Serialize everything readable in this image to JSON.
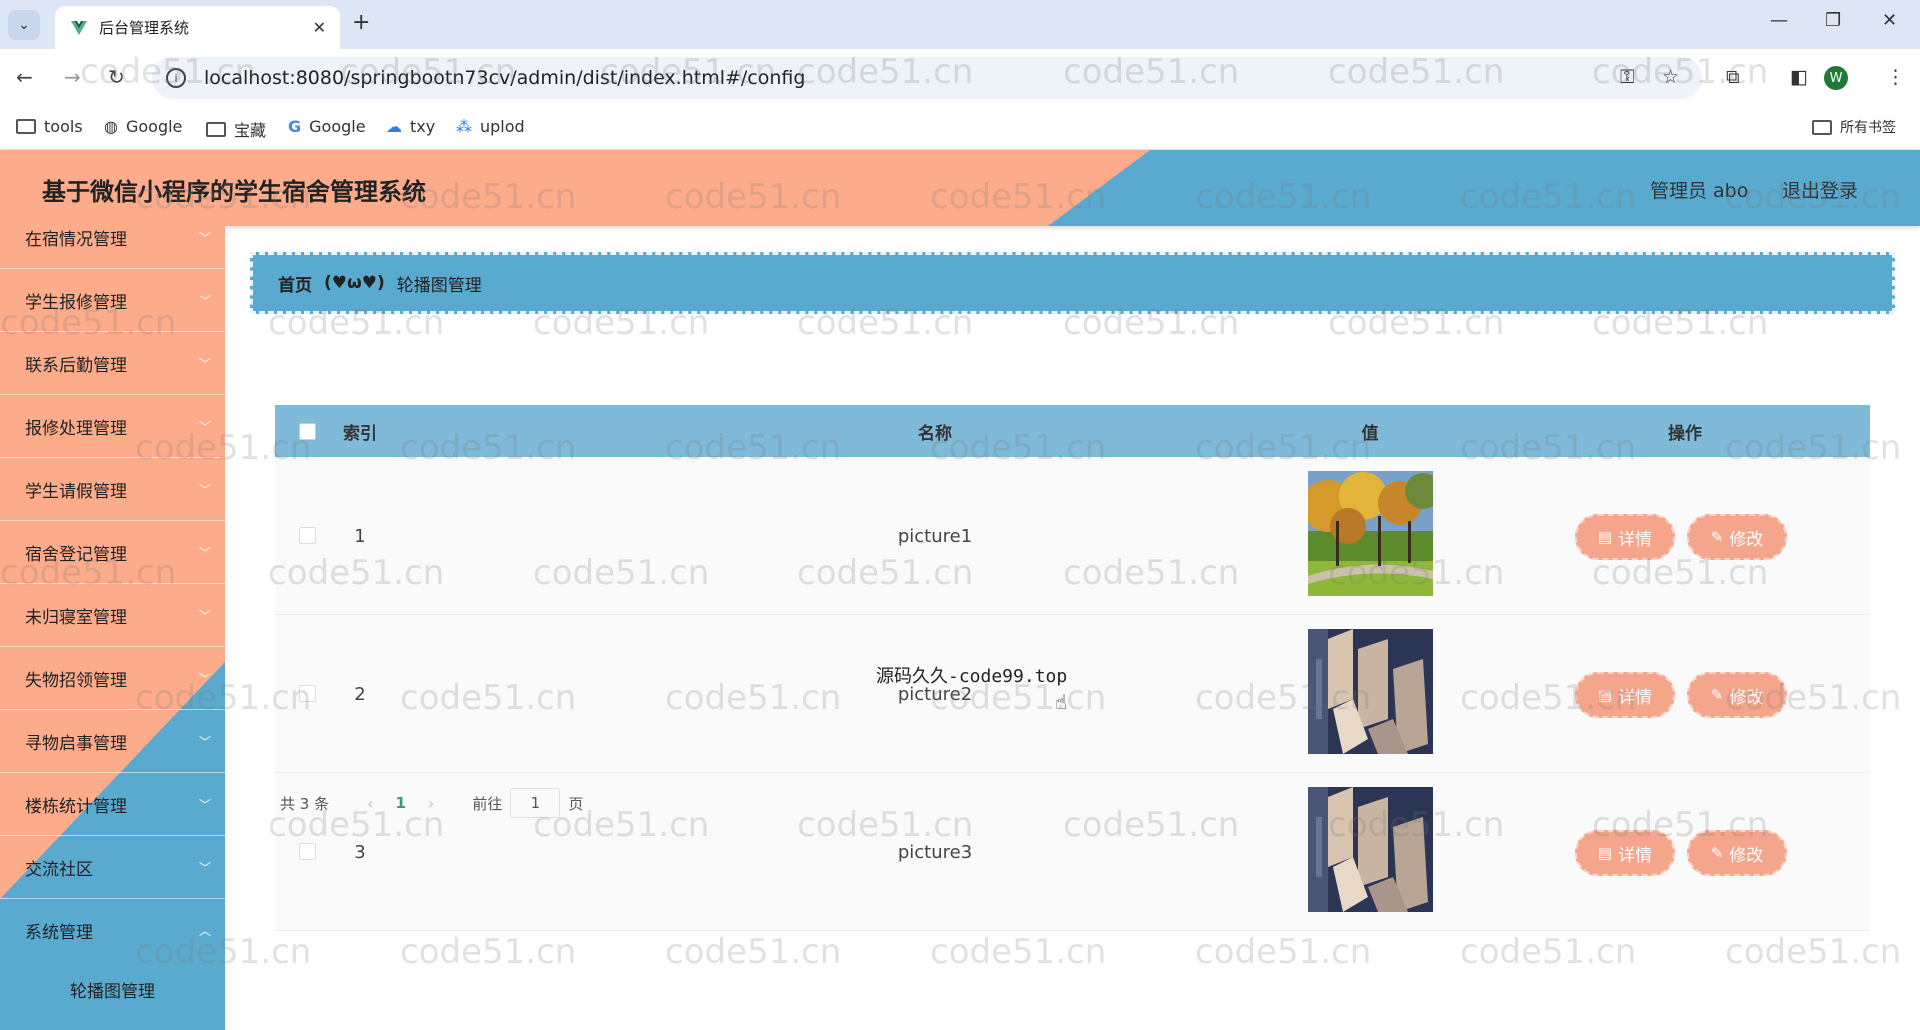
{
  "browser": {
    "tab_title": "后台管理系统",
    "url": "localhost:8080/springbootn73cv/admin/dist/index.html#/config",
    "avatar_letter": "W",
    "bookmarks": [
      {
        "label": "tools",
        "icon": "folder-icon"
      },
      {
        "label": "Google",
        "icon": "globe-icon"
      },
      {
        "label": "宝藏",
        "icon": "folder-icon"
      },
      {
        "label": "Google",
        "icon": "google-icon"
      },
      {
        "label": "txy",
        "icon": "cloud-icon"
      },
      {
        "label": "uplod",
        "icon": "cluster-icon"
      }
    ],
    "all_bookmarks": "所有书签"
  },
  "header": {
    "title": "基于微信小程序的学生宿舍管理系统",
    "user": "管理员 abo",
    "logout": "退出登录"
  },
  "sidebar": {
    "items": [
      {
        "label": "在宿情况管理"
      },
      {
        "label": "学生报修管理"
      },
      {
        "label": "联系后勤管理"
      },
      {
        "label": "报修处理管理"
      },
      {
        "label": "学生请假管理"
      },
      {
        "label": "宿舍登记管理"
      },
      {
        "label": "未归寝室管理"
      },
      {
        "label": "失物招领管理"
      },
      {
        "label": "寻物启事管理"
      },
      {
        "label": "楼栋统计管理"
      },
      {
        "label": "交流社区"
      },
      {
        "label": "系统管理"
      }
    ],
    "submenu": {
      "label": "轮播图管理"
    }
  },
  "breadcrumb": {
    "home": "首页",
    "separator": "(♥ω♥)",
    "current": "轮播图管理"
  },
  "table": {
    "headers": {
      "index": "索引",
      "name": "名称",
      "value": "值",
      "actions": "操作"
    },
    "rows": [
      {
        "index": "1",
        "name": "picture1",
        "image": "autumn-park"
      },
      {
        "index": "2",
        "name": "picture2",
        "image": "architecture"
      },
      {
        "index": "3",
        "name": "picture3",
        "image": "architecture"
      }
    ],
    "detail_label": "详情",
    "edit_label": "修改"
  },
  "overlay_text": "源码久久-code99.top",
  "pagination": {
    "total": "共 3 条",
    "current_page": "1",
    "goto_label": "前往",
    "goto_value": "1",
    "page_suffix": "页"
  },
  "watermark": "code51.cn",
  "colors": {
    "salmon": "#fdac8b",
    "blue": "#5aaacf",
    "table_header": "#7fbad8",
    "button": "#f4a58b"
  }
}
